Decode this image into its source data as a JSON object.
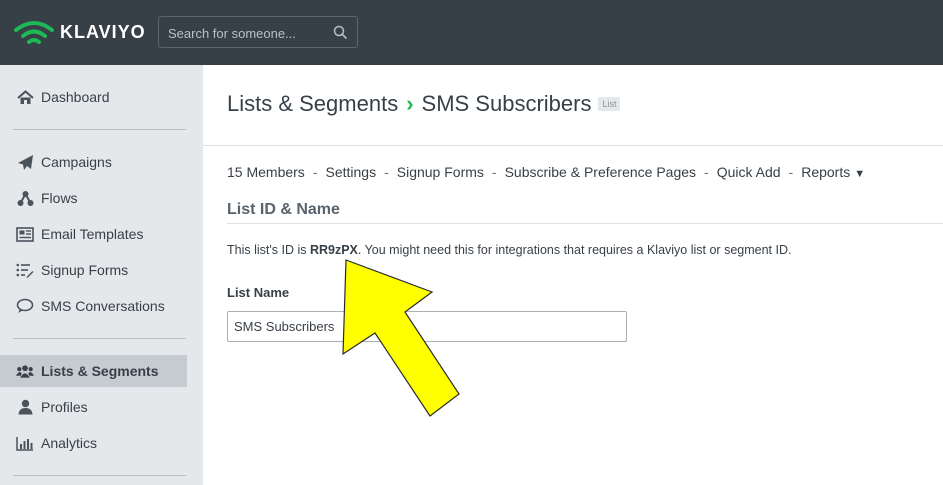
{
  "brand": {
    "name": "KLAVIYO",
    "color": "#1db954"
  },
  "search": {
    "placeholder": "Search for someone..."
  },
  "sidebar": {
    "items": [
      {
        "label": "Dashboard",
        "icon": "home-icon"
      },
      {
        "label": "Campaigns",
        "icon": "paper-plane-icon"
      },
      {
        "label": "Flows",
        "icon": "flow-icon"
      },
      {
        "label": "Email Templates",
        "icon": "newspaper-icon"
      },
      {
        "label": "Signup Forms",
        "icon": "list-pen-icon"
      },
      {
        "label": "SMS Conversations",
        "icon": "chat-icon"
      },
      {
        "label": "Lists & Segments",
        "icon": "users-icon",
        "active": true
      },
      {
        "label": "Profiles",
        "icon": "user-icon"
      },
      {
        "label": "Analytics",
        "icon": "bar-chart-icon"
      }
    ]
  },
  "breadcrumb": {
    "parent": "Lists & Segments",
    "separator": "›",
    "current": "SMS Subscribers",
    "badge": "List"
  },
  "subnav": {
    "members": "15 Members",
    "settings": "Settings",
    "signup_forms": "Signup Forms",
    "pages": "Subscribe & Preference Pages",
    "quick_add": "Quick Add",
    "reports": "Reports",
    "separator": "-"
  },
  "section": {
    "title": "List ID & Name"
  },
  "info": {
    "prefix": "This list's ID is ",
    "list_id": "RR9zPX",
    "suffix": ". You might need this for integrations that requires a Klaviyo list or segment ID."
  },
  "form": {
    "label": "List Name",
    "value": "SMS Subscribers"
  },
  "annotation": {
    "arrow_color": "#ffff00"
  }
}
